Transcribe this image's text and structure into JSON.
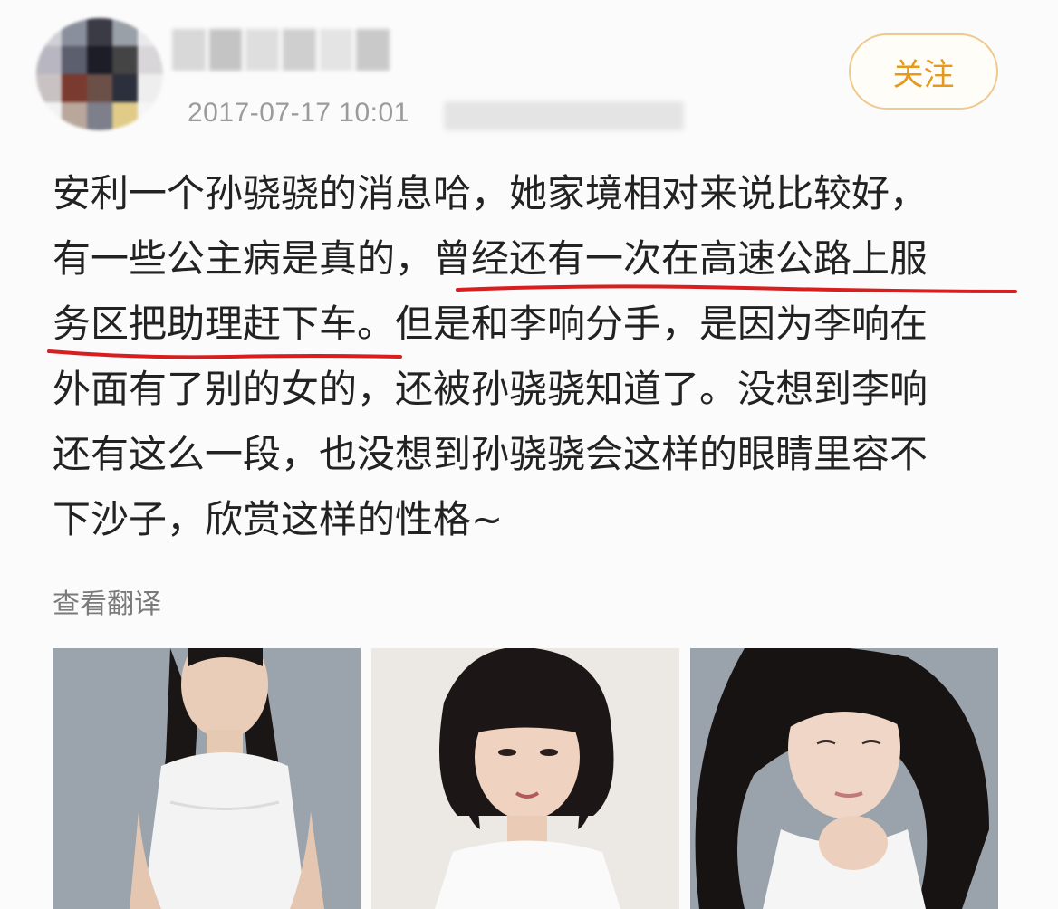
{
  "header": {
    "timestamp": "2017-07-17 10:01",
    "follow_label": "关注"
  },
  "post": {
    "lines": [
      "安利一个孙骁骁的消息哈，她家境相对来说比较好，",
      "有一些公主病是真的，",
      "曾经还有一次在高速公路上服",
      "务区把助理赶下车",
      "。但是和李响分手，是因为李响在",
      "外面有了别的女的，还被孙骁骁知道了。没想到李响",
      "还有这么一段，也没想到孙骁骁会这样的眼睛里容不",
      "下沙子，欣赏这样的性格~"
    ],
    "highlight_color": "#d81e1e",
    "translate_label": "查看翻译"
  },
  "photos": [
    {
      "icon": "woman-portrait-white-dress"
    },
    {
      "icon": "woman-portrait-bob-haircut"
    },
    {
      "icon": "woman-portrait-long-hair"
    }
  ]
}
